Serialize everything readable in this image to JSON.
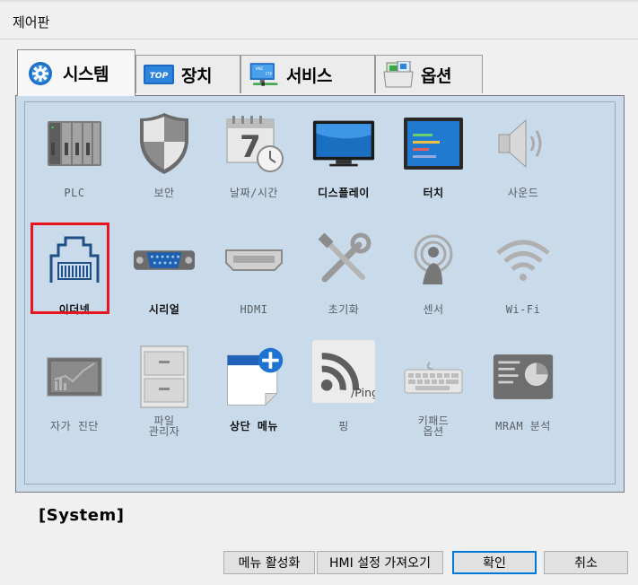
{
  "window": {
    "title": "제어판"
  },
  "tabs": [
    {
      "label": "시스템",
      "icon": "gear-icon",
      "active": true
    },
    {
      "label": "장치",
      "icon": "top-device-icon",
      "active": false
    },
    {
      "label": "서비스",
      "icon": "vnc-ftp-monitor-icon",
      "active": false
    },
    {
      "label": "옵션",
      "icon": "options-folder-icon",
      "active": false
    }
  ],
  "items": [
    {
      "label": "PLC",
      "icon": "plc-icon"
    },
    {
      "label": "보안",
      "icon": "shield-icon"
    },
    {
      "label": "날짜/시간",
      "icon": "calendar-clock-icon"
    },
    {
      "label": "디스플레이",
      "icon": "monitor-icon"
    },
    {
      "label": "터치",
      "icon": "touch-screen-icon"
    },
    {
      "label": "사운드",
      "icon": "speaker-icon"
    },
    {
      "label": "이더넷",
      "icon": "ethernet-port-icon",
      "selected": true
    },
    {
      "label": "시리얼",
      "icon": "serial-port-icon"
    },
    {
      "label": "HDMI",
      "icon": "hdmi-port-icon"
    },
    {
      "label": "초기화",
      "icon": "tools-icon"
    },
    {
      "label": "센서",
      "icon": "sensor-icon"
    },
    {
      "label": "Wi-Fi",
      "icon": "wifi-icon"
    },
    {
      "label": "자가 진단",
      "icon": "diagnostic-chart-icon"
    },
    {
      "label": "파일\n관리자",
      "icon": "file-cabinet-icon"
    },
    {
      "label": "상단 메뉴",
      "icon": "top-menu-add-icon"
    },
    {
      "label": "핑",
      "icon": "ping-icon",
      "badge": "/Ping"
    },
    {
      "label": "키패드\n옵션",
      "icon": "keyboard-icon"
    },
    {
      "label": "MRAM 분석",
      "icon": "mram-chart-icon"
    }
  ],
  "status": {
    "text": "[System]"
  },
  "buttons": {
    "activate_menu": "메뉴 활성화",
    "import_hmi": "HMI 설정 가져오기",
    "ok": "확인",
    "cancel": "취소"
  },
  "icon_text": {
    "top": "TOP",
    "vnc": "VNC",
    "ftp": "FTP",
    "clock_digit": "7"
  },
  "colors": {
    "highlight": "#e8141e",
    "panel": "#c9dbeb",
    "accent": "#0078d7"
  }
}
